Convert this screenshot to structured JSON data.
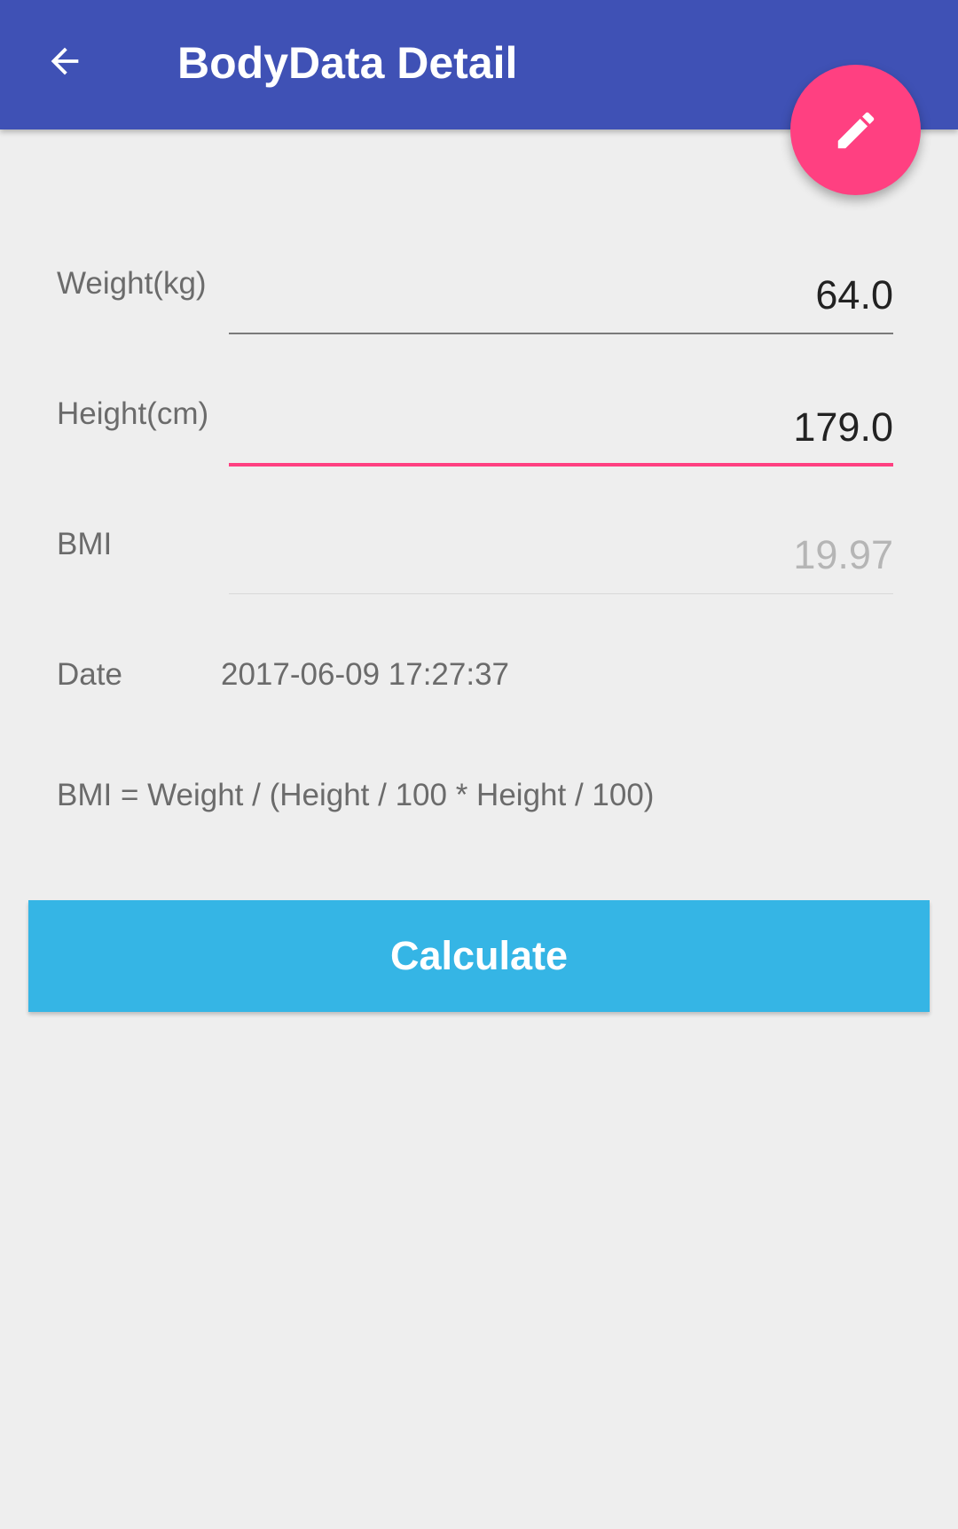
{
  "toolbar": {
    "title": "BodyData Detail",
    "back_icon": "arrow-left-icon",
    "color": "#3f51b5"
  },
  "fab": {
    "icon": "pencil-icon",
    "color": "#ff4081"
  },
  "form": {
    "weight": {
      "label": "Weight(kg)",
      "value": "64.0"
    },
    "height": {
      "label": "Height(cm)",
      "value": "179.0"
    },
    "bmi": {
      "label": "BMI",
      "value": "19.97"
    },
    "date": {
      "label": "Date",
      "value": "2017-06-09 17:27:37"
    }
  },
  "formula": "BMI = Weight / (Height / 100 * Height / 100)",
  "calculate_button": {
    "label": "Calculate",
    "color": "#35b5e5"
  }
}
